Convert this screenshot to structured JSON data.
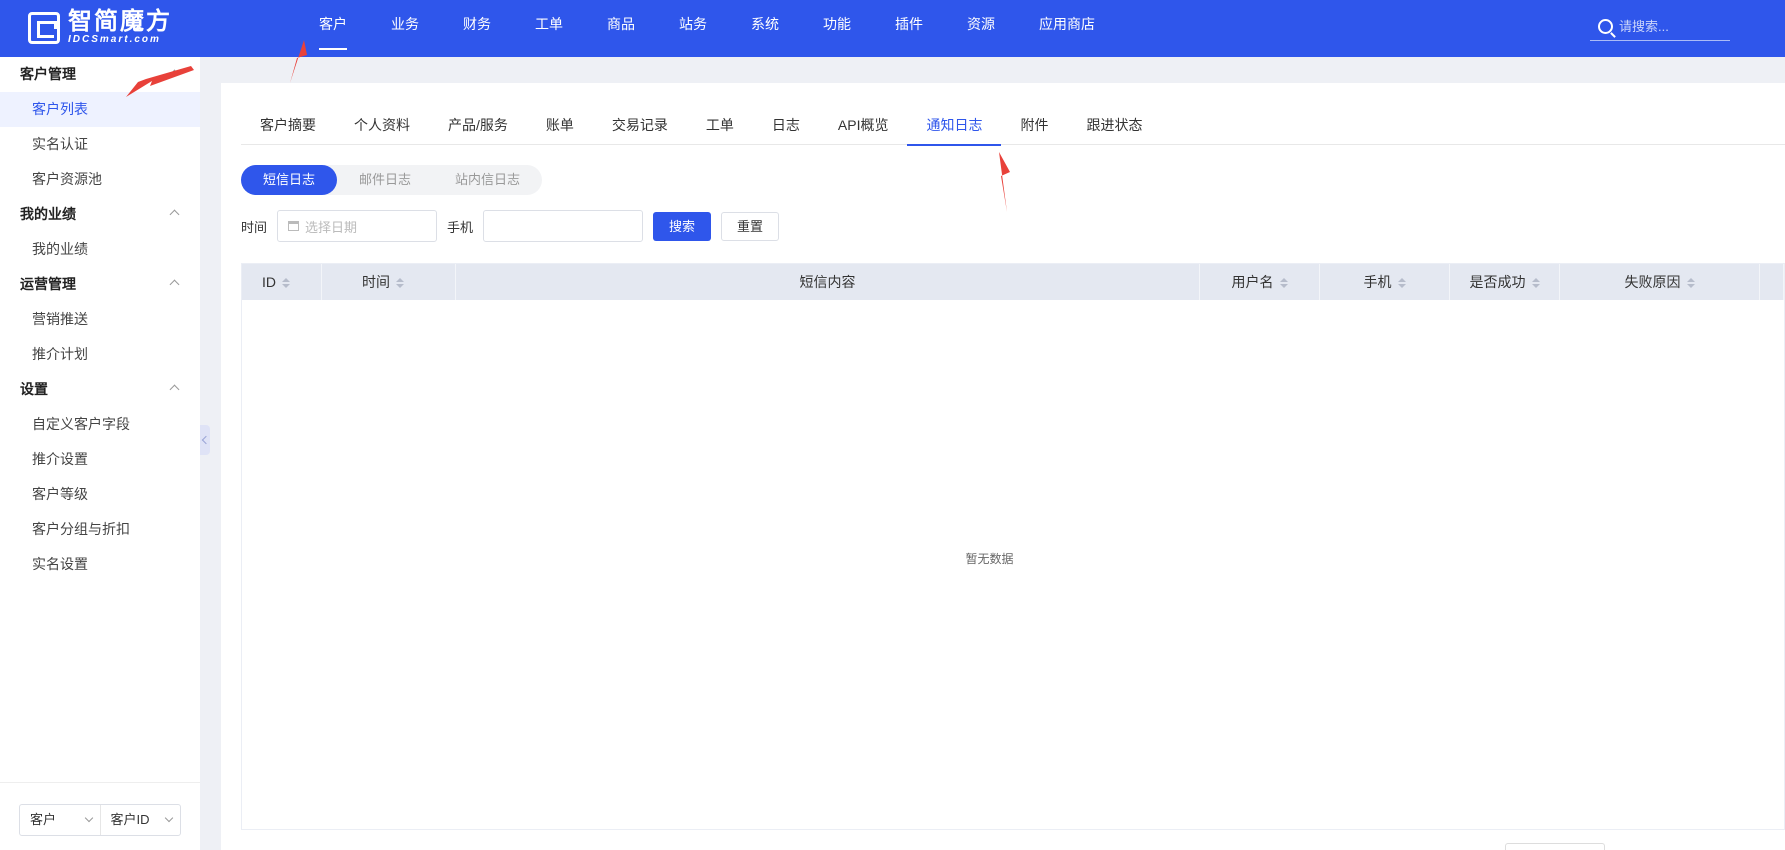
{
  "brand": {
    "name_cn": "智简魔方",
    "name_en": "IDCSmart.com"
  },
  "topnav": {
    "items": [
      "客户",
      "业务",
      "财务",
      "工单",
      "商品",
      "站务",
      "系统",
      "功能",
      "插件",
      "资源",
      "应用商店"
    ],
    "active_index": 0
  },
  "search": {
    "placeholder": "请搜索..."
  },
  "sidebar": {
    "groups": [
      {
        "title": "客户管理",
        "items": [
          "客户列表",
          "实名认证",
          "客户资源池"
        ]
      },
      {
        "title": "我的业绩",
        "items": [
          "我的业绩"
        ]
      },
      {
        "title": "运营管理",
        "items": [
          "营销推送",
          "推介计划"
        ]
      },
      {
        "title": "设置",
        "items": [
          "自定义客户字段",
          "推介设置",
          "客户等级",
          "客户分组与折扣",
          "实名设置"
        ]
      }
    ],
    "active_item": "客户列表",
    "footer": {
      "type_select": "客户",
      "field_select": "客户ID"
    }
  },
  "tabs": {
    "items": [
      "客户摘要",
      "个人资料",
      "产品/服务",
      "账单",
      "交易记录",
      "工单",
      "日志",
      "API概览",
      "通知日志",
      "附件",
      "跟进状态"
    ],
    "active_index": 8
  },
  "subtabs": {
    "items": [
      "短信日志",
      "邮件日志",
      "站内信日志"
    ],
    "active_index": 0
  },
  "filter": {
    "time_label": "时间",
    "date_placeholder": "选择日期",
    "phone_label": "手机",
    "phone_value": "",
    "search_button": "搜索",
    "reset_button": "重置"
  },
  "table": {
    "columns": [
      "ID",
      "时间",
      "短信内容",
      "用户名",
      "手机",
      "是否成功",
      "失败原因"
    ],
    "sortable": [
      true,
      true,
      false,
      true,
      true,
      true,
      true
    ],
    "rows": [],
    "empty_text": "暂无数据"
  },
  "colors": {
    "primary": "#2f56eb",
    "annotation_arrow": "#e8413a"
  }
}
